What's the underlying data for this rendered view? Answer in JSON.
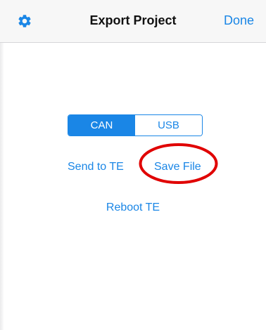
{
  "header": {
    "title": "Export Project",
    "done_label": "Done",
    "settings_icon": "gear-icon"
  },
  "segment": {
    "options": [
      "CAN",
      "USB"
    ],
    "selected": "CAN"
  },
  "actions": {
    "send_label": "Send to TE",
    "save_label": "Save File",
    "reboot_label": "Reboot TE"
  },
  "colors": {
    "accent": "#1a86e6",
    "annotation": "#e00000"
  }
}
